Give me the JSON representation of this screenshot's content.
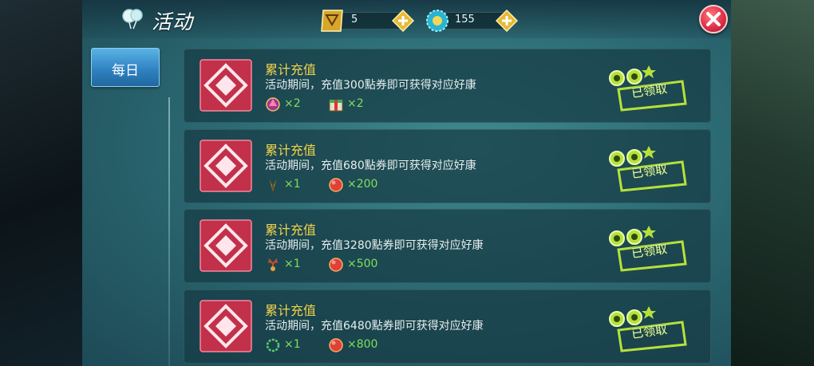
{
  "header": {
    "title": "活动",
    "currency_1": {
      "icon": "gold-ticket-icon",
      "value": "5"
    },
    "currency_2": {
      "icon": "blue-gear-coin-icon",
      "value": "155"
    }
  },
  "sidebar": {
    "tabs": [
      {
        "label": "每日",
        "active": true
      }
    ]
  },
  "activities": [
    {
      "title": "累计充值",
      "description": "活动期间，充值300點券即可获得对应好康",
      "rewards": [
        {
          "icon": "pink-crystal-icon",
          "qty": "×2"
        },
        {
          "icon": "gift-box-icon",
          "qty": "×2"
        }
      ],
      "status": "已领取"
    },
    {
      "title": "累计充值",
      "description": "活动期间，充值680點券即可获得对应好康",
      "rewards": [
        {
          "icon": "golden-wings-icon",
          "qty": "×1"
        },
        {
          "icon": "red-orb-icon",
          "qty": "×200"
        }
      ],
      "status": "已领取"
    },
    {
      "title": "累计充值",
      "description": "活动期间，充值3280點券即可获得对应好康",
      "rewards": [
        {
          "icon": "antler-ornament-icon",
          "qty": "×1"
        },
        {
          "icon": "red-orb-icon",
          "qty": "×500"
        }
      ],
      "status": "已领取"
    },
    {
      "title": "累计充值",
      "description": "活动期间，充值6480點券即可获得对应好康",
      "rewards": [
        {
          "icon": "green-wreath-icon",
          "qty": "×1"
        },
        {
          "icon": "red-orb-icon",
          "qty": "×800"
        }
      ],
      "status": "已领取"
    }
  ],
  "colors": {
    "title_gold": "#f2d24a",
    "qty_green": "#7ee05a",
    "tab_blue": "#2d7fbe",
    "close_red": "#e0304a"
  }
}
